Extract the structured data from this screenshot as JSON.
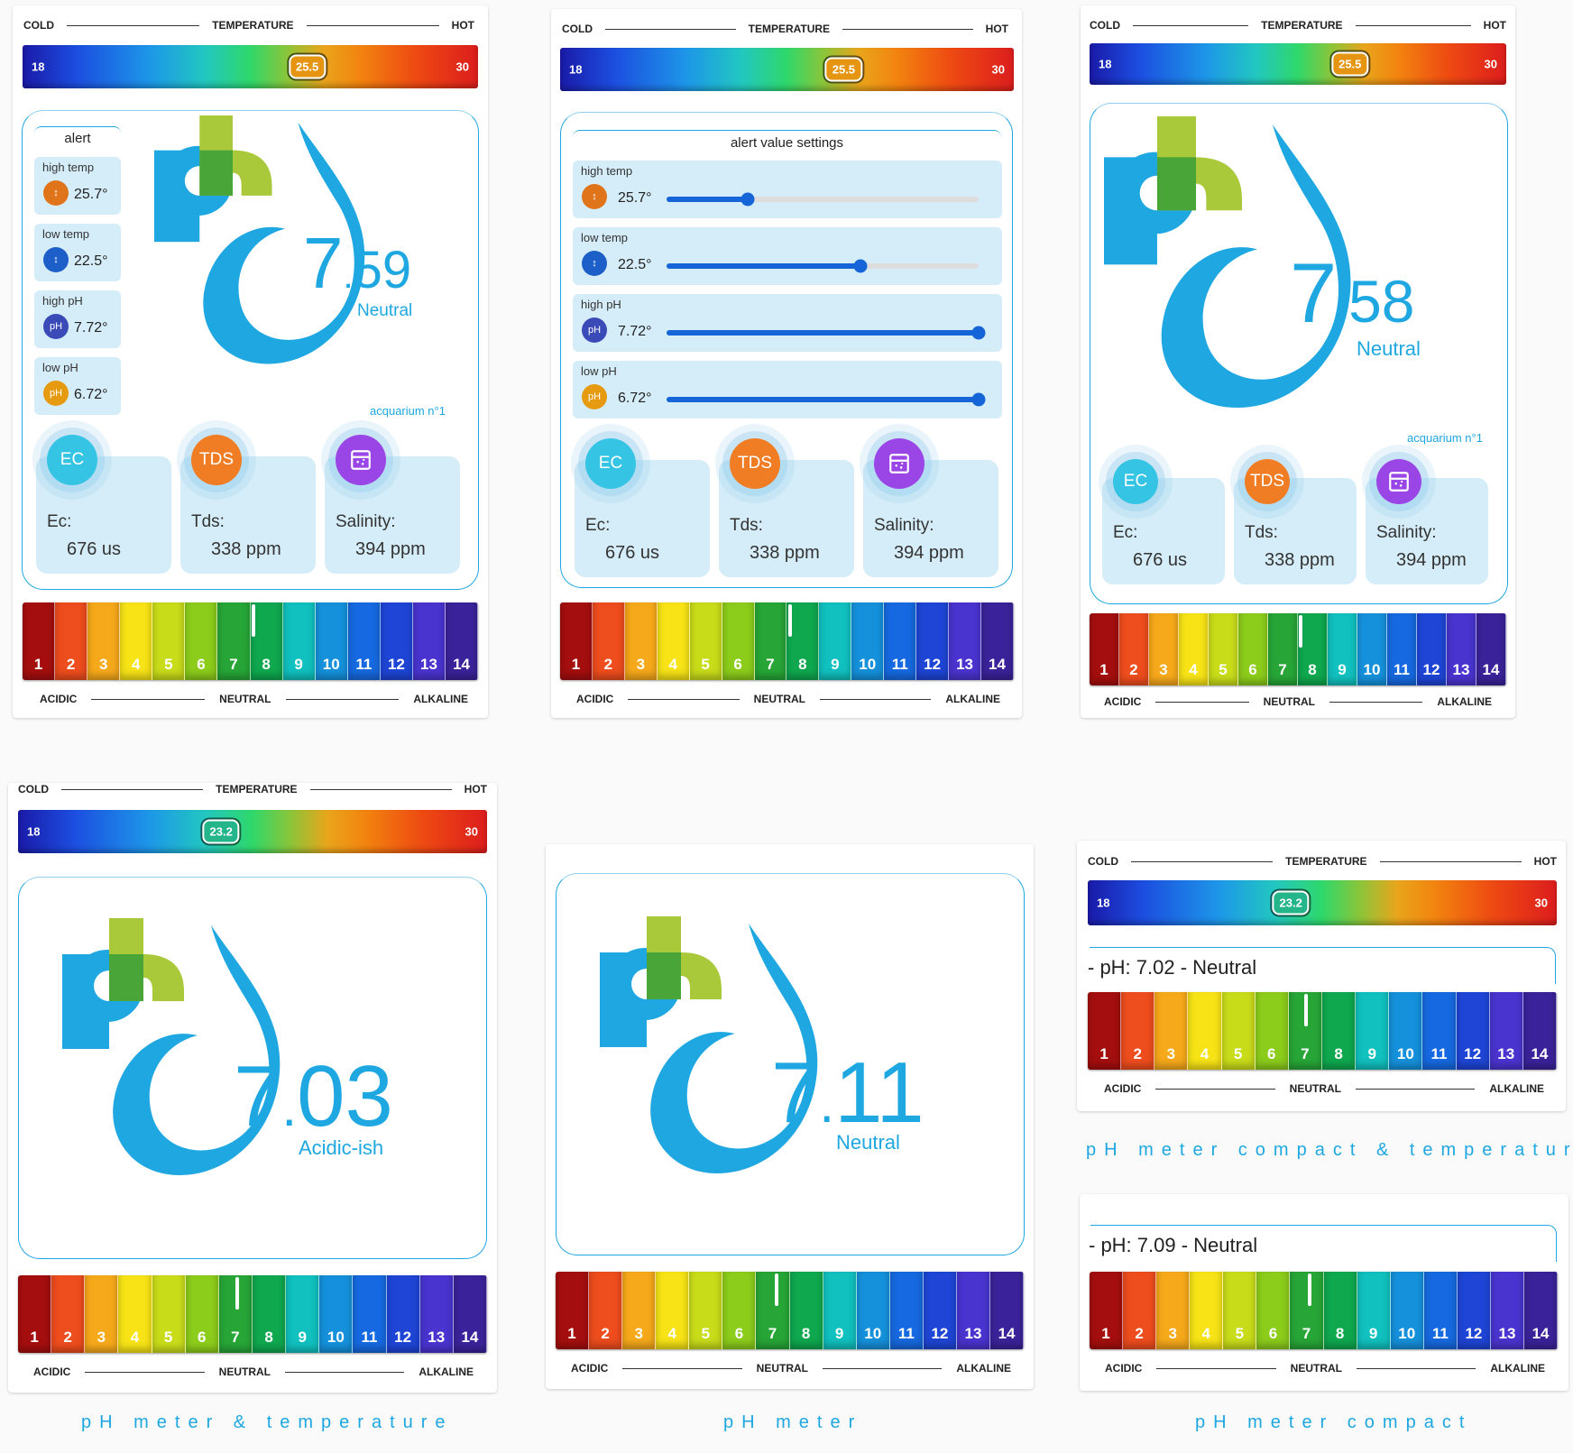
{
  "temperature_header": {
    "cold": "COLD",
    "title": "TEMPERATURE",
    "hot": "HOT",
    "min": "18",
    "max": "30"
  },
  "ph_footer": {
    "acidic": "ACIDIC",
    "neutral": "NEUTRAL",
    "alkaline": "ALKALINE"
  },
  "ph_scale_numbers": [
    "1",
    "2",
    "3",
    "4",
    "5",
    "6",
    "7",
    "8",
    "9",
    "10",
    "11",
    "12",
    "13",
    "14"
  ],
  "ph_scale_colors": [
    "#a50e0e",
    "#ee4d1d",
    "#f6a91a",
    "#f7e316",
    "#c9dc19",
    "#8ccc1b",
    "#27a637",
    "#0fa84f",
    "#10c1bf",
    "#1591dc",
    "#1669e0",
    "#1e45d6",
    "#4a34d0",
    "#3a239a"
  ],
  "ph_logo_text": "pH",
  "cards": [
    {
      "id": "card1",
      "temp": "25.5",
      "temp_fraction": 0.625,
      "ph_int": "7",
      "ph_dec": "59",
      "status": "Neutral",
      "label": "acquarium n°1",
      "ph_marker": 7.59
    },
    {
      "id": "card2",
      "temp": "25.5",
      "temp_fraction": 0.625,
      "ph_marker": 7.59
    },
    {
      "id": "card3",
      "temp": "25.5",
      "temp_fraction": 0.625,
      "ph_int": "7",
      "ph_dec": "58",
      "status": "Neutral",
      "label": "acquarium n°1",
      "ph_marker": 7.58
    },
    {
      "id": "card4",
      "temp": "23.2",
      "temp_fraction": 0.433,
      "ph_int": "7",
      "ph_dec": "03",
      "status": "Acidic-ish",
      "ph_marker": 7.03
    },
    {
      "id": "card5",
      "ph_int": "7",
      "ph_dec": "11",
      "status": "Neutral",
      "ph_marker": 7.11
    },
    {
      "id": "card6",
      "temp": "23.2",
      "temp_fraction": 0.433,
      "line": "- pH: 7.02 - Neutral",
      "ph_marker": 7.02
    },
    {
      "id": "card7",
      "line": "- pH: 7.09 - Neutral",
      "ph_marker": 7.09
    }
  ],
  "alerts": {
    "title": "alert",
    "items": [
      {
        "label": "high temp",
        "value": "25.7°",
        "icon": "thermometer-up-icon",
        "color": "#e0741a"
      },
      {
        "label": "low temp",
        "value": "22.5°",
        "icon": "thermometer-down-icon",
        "color": "#1d5fc8"
      },
      {
        "label": "high pH",
        "value": "7.72°",
        "icon": "ph-badge-icon",
        "icon_text": "pH",
        "color": "#3a4bb8"
      },
      {
        "label": "low pH",
        "value": "6.72°",
        "icon": "ph-badge-icon",
        "icon_text": "pH",
        "color": "#e69a10"
      }
    ]
  },
  "alert_settings": {
    "title": "alert value settings",
    "items": [
      {
        "label": "high temp",
        "value": "25.7°",
        "level": 0.26
      },
      {
        "label": "low temp",
        "value": "22.5°",
        "level": 0.62
      },
      {
        "label": "high pH",
        "value": "7.72°",
        "level": 1.0
      },
      {
        "label": "low pH",
        "value": "6.72°",
        "level": 1.0
      }
    ]
  },
  "sensors": [
    {
      "badge": "EC",
      "label": "Ec:",
      "value": "676 us",
      "icon": "ec-icon",
      "color": "#36c4e4"
    },
    {
      "badge": "TDS",
      "label": "Tds:",
      "value": "338 ppm",
      "icon": "tds-icon",
      "color": "#f07c24"
    },
    {
      "badge": "",
      "label": "Salinity:",
      "value": "394 ppm",
      "icon": "beaker-icon",
      "color": "#9a46e6"
    }
  ],
  "captions": {
    "compact_temp": "pH meter compact & temperature",
    "meter_temp": "pH meter & temperature",
    "meter": "pH meter",
    "compact": "pH meter compact"
  }
}
